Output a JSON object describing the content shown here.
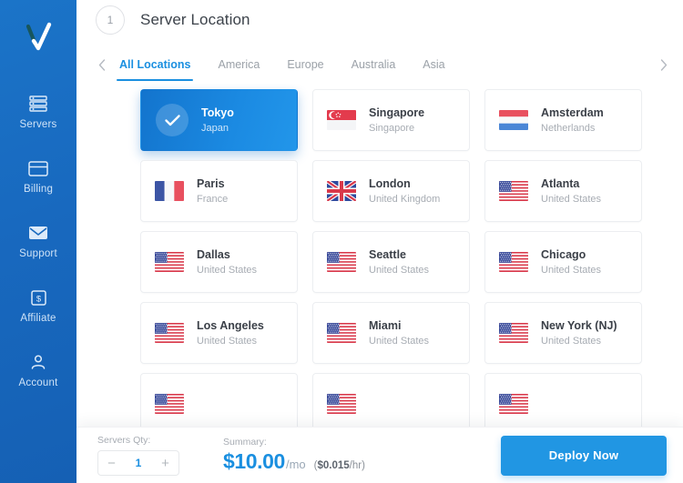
{
  "brand": {
    "logo_icon": "checkmark-v-logo",
    "accent": "#1a8fe0",
    "sidebar_color": "#1869bf"
  },
  "sidebar": {
    "items": [
      {
        "label": "Servers",
        "icon": "servers-icon"
      },
      {
        "label": "Billing",
        "icon": "credit-card-icon"
      },
      {
        "label": "Support",
        "icon": "envelope-icon"
      },
      {
        "label": "Affiliate",
        "icon": "dollar-box-icon"
      },
      {
        "label": "Account",
        "icon": "person-icon"
      }
    ]
  },
  "header": {
    "step_number": "1",
    "title": "Server Location"
  },
  "tabs": {
    "prev_icon": "chevron-left-icon",
    "next_icon": "chevron-right-icon",
    "items": [
      {
        "label": "All Locations",
        "active": true
      },
      {
        "label": "America",
        "active": false
      },
      {
        "label": "Europe",
        "active": false
      },
      {
        "label": "Australia",
        "active": false
      },
      {
        "label": "Asia",
        "active": false
      }
    ]
  },
  "locations": [
    {
      "city": "Tokyo",
      "country": "Japan",
      "flag": "jp",
      "selected": true
    },
    {
      "city": "Singapore",
      "country": "Singapore",
      "flag": "sg",
      "selected": false
    },
    {
      "city": "Amsterdam",
      "country": "Netherlands",
      "flag": "nl",
      "selected": false
    },
    {
      "city": "Paris",
      "country": "France",
      "flag": "fr",
      "selected": false
    },
    {
      "city": "London",
      "country": "United Kingdom",
      "flag": "gb",
      "selected": false
    },
    {
      "city": "Atlanta",
      "country": "United States",
      "flag": "us",
      "selected": false
    },
    {
      "city": "Dallas",
      "country": "United States",
      "flag": "us",
      "selected": false
    },
    {
      "city": "Seattle",
      "country": "United States",
      "flag": "us",
      "selected": false
    },
    {
      "city": "Chicago",
      "country": "United States",
      "flag": "us",
      "selected": false
    },
    {
      "city": "Los Angeles",
      "country": "United States",
      "flag": "us",
      "selected": false
    },
    {
      "city": "Miami",
      "country": "United States",
      "flag": "us",
      "selected": false
    },
    {
      "city": "New York (NJ)",
      "country": "United States",
      "flag": "us",
      "selected": false
    },
    {
      "city": "",
      "country": "",
      "flag": "us",
      "selected": false
    },
    {
      "city": "",
      "country": "",
      "flag": "us",
      "selected": false
    },
    {
      "city": "",
      "country": "",
      "flag": "us",
      "selected": false
    }
  ],
  "selected_check_icon": "check-icon",
  "footer": {
    "qty_label": "Servers Qty:",
    "qty_value": "1",
    "decrement_label": "−",
    "increment_label": "+",
    "summary_label": "Summary:",
    "price_monthly": "$10.00",
    "price_monthly_suffix": "/mo",
    "price_hourly_amount": "$0.015",
    "price_hourly_suffix": "/hr)",
    "price_hourly_open": "(",
    "deploy_label": "Deploy Now"
  }
}
